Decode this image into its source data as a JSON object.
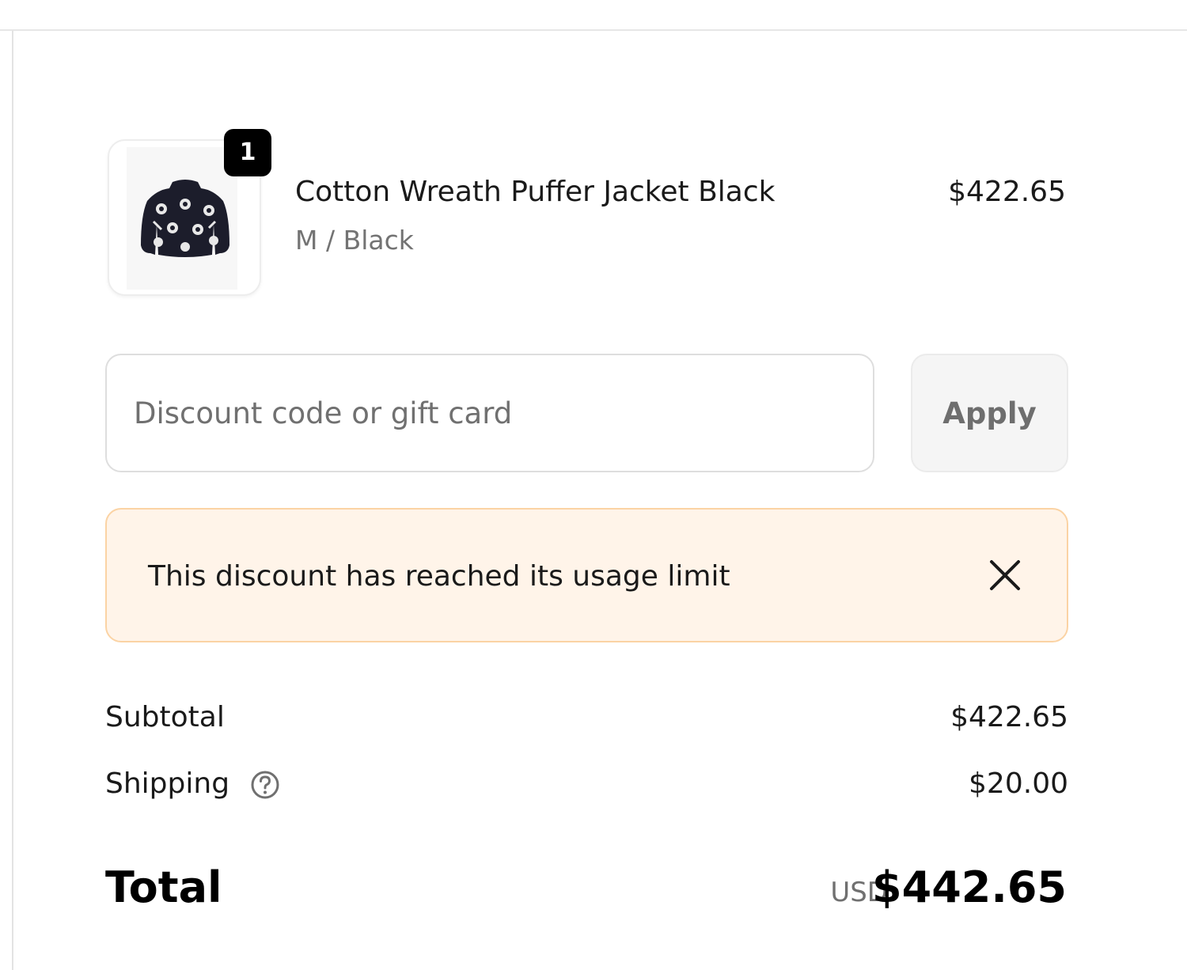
{
  "order": {
    "items": [
      {
        "quantity": "1",
        "title": "Cotton Wreath Puffer Jacket Black",
        "variant": "M / Black",
        "price": "$422.65",
        "image_icon": "jacket-product-image"
      }
    ]
  },
  "discount": {
    "placeholder": "Discount code or gift card",
    "value": "",
    "apply_label": "Apply"
  },
  "alert": {
    "message": "This discount has reached its usage limit",
    "close_icon": "close-icon",
    "background": "#fff4e9",
    "border": "#fbd3a4"
  },
  "totals": {
    "subtotal_label": "Subtotal",
    "subtotal_value": "$422.65",
    "shipping_label": "Shipping",
    "shipping_help_icon": "question-circle-icon",
    "shipping_value": "$20.00",
    "total_label": "Total",
    "currency": "USD",
    "total_value": "$442.65"
  }
}
